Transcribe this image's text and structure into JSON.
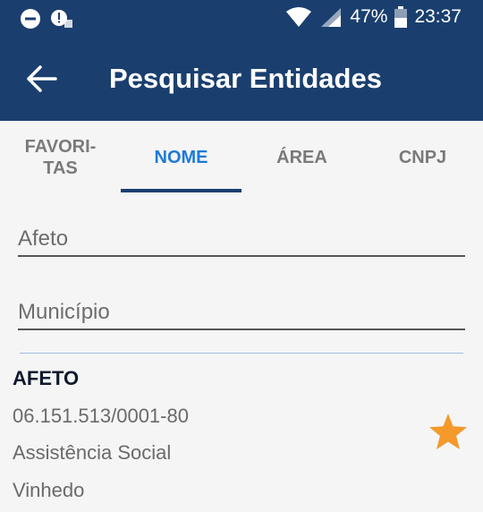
{
  "status_bar": {
    "battery_percent": "47%",
    "time": "23:37"
  },
  "toolbar": {
    "title": "Pesquisar Entidades"
  },
  "tabs": [
    {
      "label_line1": "FAVORI-",
      "label_line2": "TAS"
    },
    {
      "label": "NOME"
    },
    {
      "label": "ÁREA"
    },
    {
      "label": "CNPJ"
    }
  ],
  "search": {
    "name_value": "Afeto",
    "municipio_placeholder": "Município"
  },
  "result": {
    "name": "AFETO",
    "cnpj": "06.151.513/0001-80",
    "area": "Assistência Social",
    "city": "Vinhedo"
  },
  "colors": {
    "appbar": "#1a3f6f",
    "active_tab": "#1e7ad8",
    "star": "#f39a2b"
  }
}
